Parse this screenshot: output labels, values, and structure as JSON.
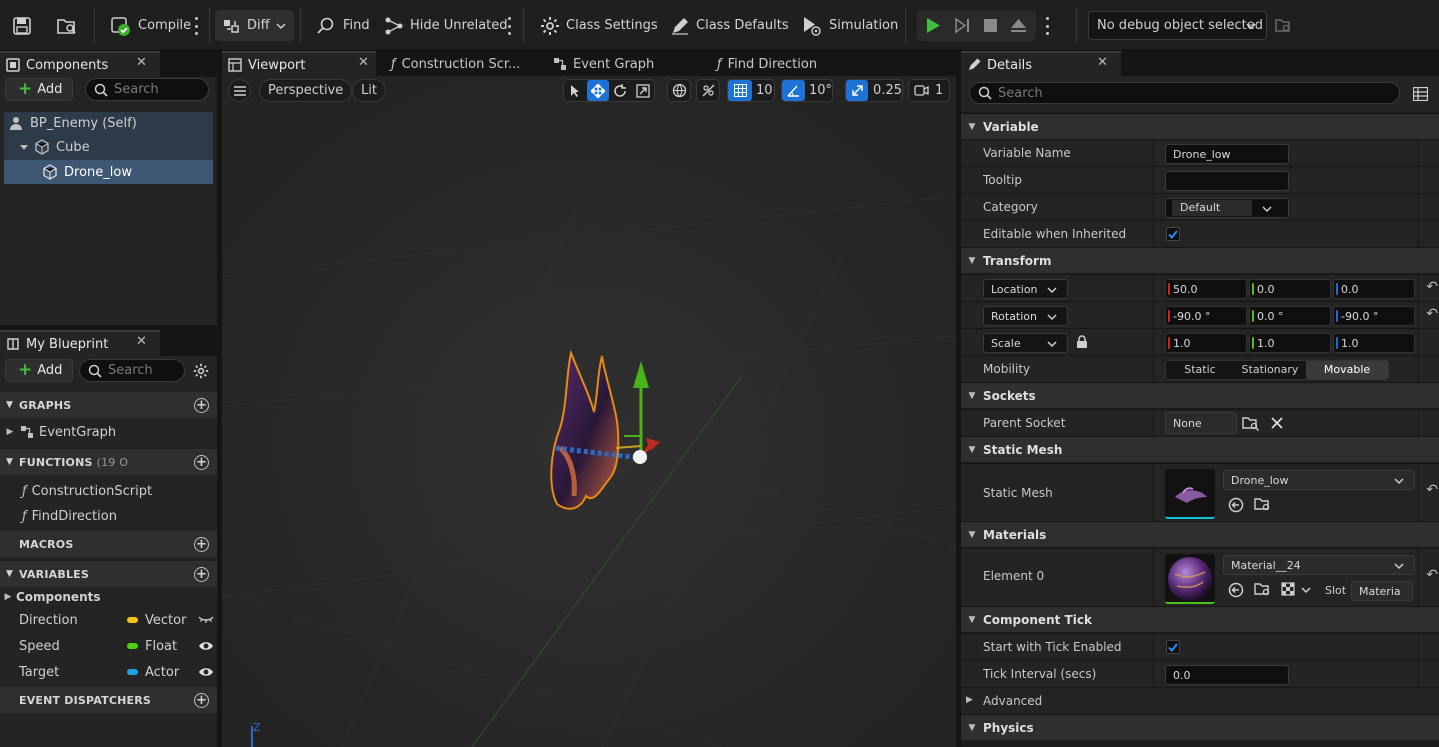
{
  "toolbar": {
    "compile": "Compile",
    "diff": "Diff",
    "find": "Find",
    "hide_unrelated": "Hide Unrelated",
    "class_settings": "Class Settings",
    "class_defaults": "Class Defaults",
    "simulation": "Simulation",
    "debug_object": "No debug object selected"
  },
  "components": {
    "tab": "Components",
    "add": "Add",
    "search_placeholder": "Search",
    "tree": [
      "BP_Enemy (Self)",
      "Cube",
      "Drone_low"
    ],
    "selected": "Drone_low"
  },
  "my_blueprint": {
    "tab": "My Blueprint",
    "add": "Add",
    "search_placeholder": "Search",
    "graphs_header": "GRAPHS",
    "graphs": [
      "EventGraph"
    ],
    "functions_header": "FUNCTIONS",
    "functions_count": "(19 O",
    "functions": [
      "ConstructionScript",
      "FindDirection"
    ],
    "macros_header": "MACROS",
    "variables_header": "VARIABLES",
    "components_category": "Components",
    "variables": [
      {
        "name": "Direction",
        "type": "Vector",
        "color": "#f5c218",
        "visible": false
      },
      {
        "name": "Speed",
        "type": "Float",
        "color": "#48d40c",
        "visible": true
      },
      {
        "name": "Target",
        "type": "Actor",
        "color": "#1aa5e6",
        "visible": true
      }
    ],
    "dispatchers_header": "EVENT DISPATCHERS"
  },
  "editor_tabs": [
    "Viewport",
    "Construction Scr...",
    "Event Graph",
    "Find Direction"
  ],
  "viewport": {
    "perspective": "Perspective",
    "lit": "Lit",
    "grid_snap": "10",
    "rot_snap": "10°",
    "scale_snap": "0.25",
    "camera_speed": "1",
    "axis_label": "Z"
  },
  "details": {
    "tab": "Details",
    "search_placeholder": "Search",
    "variable_section": "Variable",
    "variable_name_label": "Variable Name",
    "variable_name": "Drone_low",
    "tooltip_label": "Tooltip",
    "tooltip": "",
    "category_label": "Category",
    "category": "Default",
    "editable_label": "Editable when Inherited",
    "transform_section": "Transform",
    "location_label": "Location",
    "location": [
      "50.0",
      "0.0",
      "0.0"
    ],
    "rotation_label": "Rotation",
    "rotation": [
      "-90.0 °",
      "0.0 °",
      "-90.0 °"
    ],
    "scale_label": "Scale",
    "scale": [
      "1.0",
      "1.0",
      "1.0"
    ],
    "mobility_label": "Mobility",
    "mobility_options": [
      "Static",
      "Stationary",
      "Movable"
    ],
    "mobility_selected": "Movable",
    "sockets_section": "Sockets",
    "parent_socket_label": "Parent Socket",
    "parent_socket": "None",
    "static_mesh_section": "Static Mesh",
    "static_mesh_label": "Static Mesh",
    "static_mesh": "Drone_low",
    "materials_section": "Materials",
    "element0_label": "Element 0",
    "material": "Material__24",
    "slot_label": "Slot",
    "slot_value": "Materia",
    "component_tick_section": "Component Tick",
    "start_tick_label": "Start with Tick Enabled",
    "tick_interval_label": "Tick Interval (secs)",
    "tick_interval": "0.0",
    "advanced_label": "Advanced",
    "physics_section": "Physics"
  }
}
